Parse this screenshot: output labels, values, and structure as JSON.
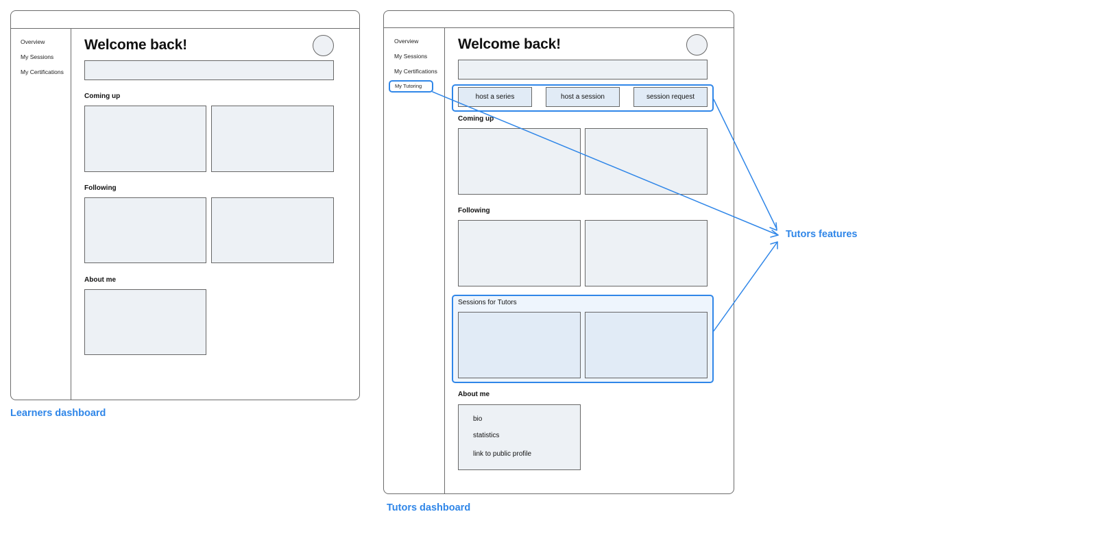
{
  "learners": {
    "caption": "Learners dashboard",
    "nav": [
      "Overview",
      "My Sessions",
      "My Certifications"
    ],
    "title": "Welcome back!",
    "sections": {
      "coming_up": "Coming up",
      "following": "Following",
      "about_me": "About me"
    }
  },
  "tutors": {
    "caption": "Tutors dashboard",
    "nav": [
      "Overview",
      "My Sessions",
      "My Certifications",
      "My Tutoring"
    ],
    "title": "Welcome back!",
    "actions": [
      "host a series",
      "host a session",
      "session request"
    ],
    "sections": {
      "coming_up": "Coming up",
      "following": "Following",
      "sessions_for_tutors": "Sessions for Tutors",
      "about_me": "About me"
    },
    "about_items": [
      "bio",
      "statistics",
      "link to public profile"
    ]
  },
  "annotation": {
    "label": "Tutors features",
    "color": "#2f86e8"
  }
}
